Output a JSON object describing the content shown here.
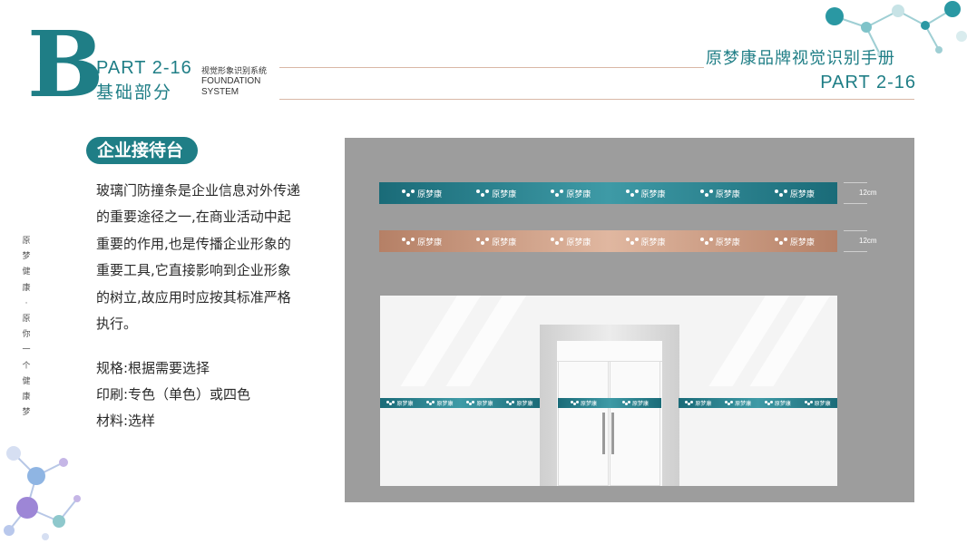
{
  "header": {
    "letter": "B",
    "part_code": "PART 2-16",
    "section_cn": "基础部分",
    "section_sub_cn": "视觉形象识别系统",
    "section_en_line1": "FOUNDATION",
    "section_en_line2": "SYSTEM",
    "manual_title": "原梦康品牌视觉识别手册",
    "manual_part": "PART 2-16"
  },
  "slogan": [
    "原",
    "梦",
    "健",
    "康",
    "·",
    "原",
    "你",
    "一",
    "个",
    "健",
    "康",
    "梦"
  ],
  "content": {
    "heading": "企业接待台",
    "body": "玻璃门防撞条是企业信息对外传递的重要途径之一,在商业活动中起重要的作用,也是传播企业形象的重要工具,它直接影响到企业形象的树立,故应用时应按其标准严格执行。",
    "spec_size": "规格:根据需要选择",
    "spec_print": "印刷:专色（单色）或四色",
    "spec_material": "材料:选样"
  },
  "illustration": {
    "logo_text": "原梦康",
    "dimension_1": "12cm",
    "dimension_2": "12cm"
  },
  "colors": {
    "brand_teal": "#1f7e86",
    "band_teal": "#2f8c98",
    "band_bronze": "#c99680",
    "wall_gray": "#9d9d9d",
    "rule_tan": "#d9b7a6"
  }
}
